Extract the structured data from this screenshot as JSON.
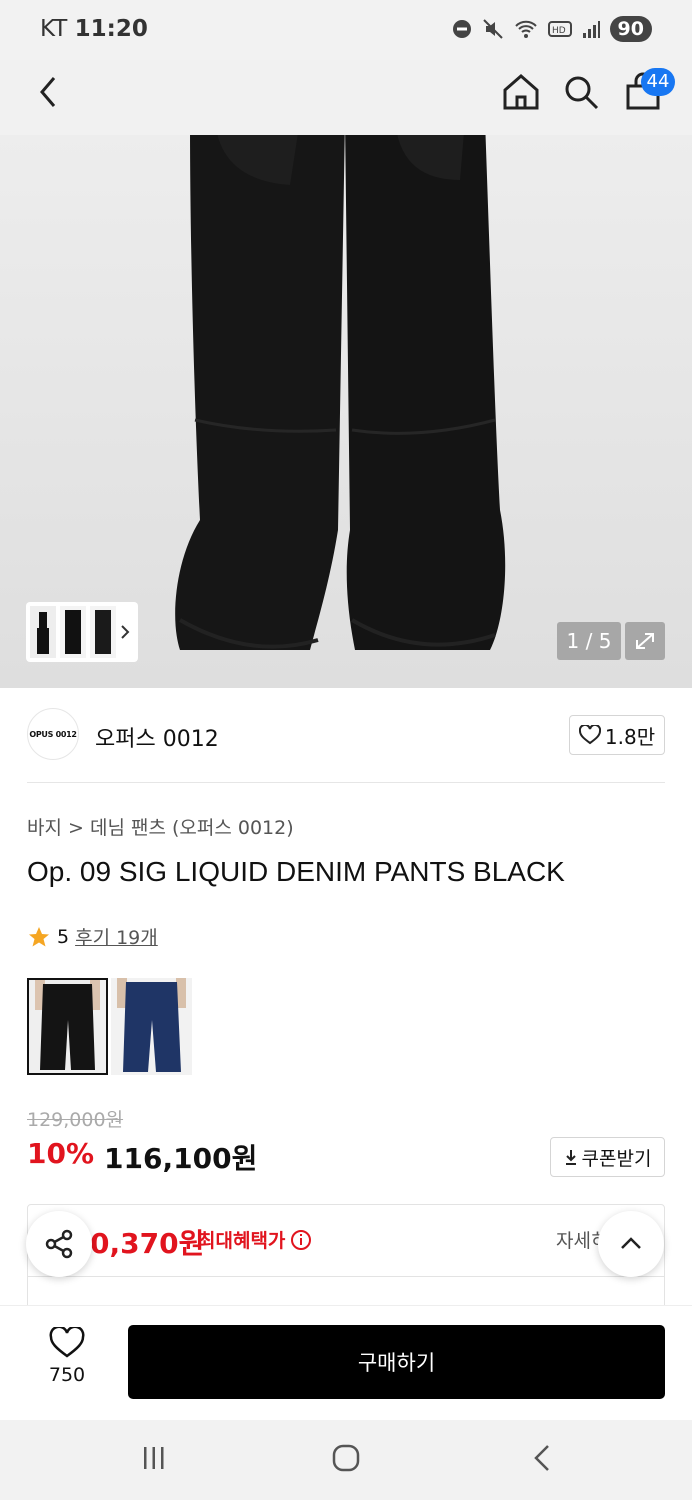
{
  "status_bar": {
    "carrier": "KT",
    "time": "11:20",
    "battery": "90"
  },
  "nav": {
    "cart_count": "44"
  },
  "gallery": {
    "counter": "1 / 5"
  },
  "brand": {
    "logo_text": "OPUS 0012",
    "name": "오퍼스 0012",
    "likes": "1.8만"
  },
  "product": {
    "breadcrumb": "바지 > 데님 팬츠 (오퍼스 0012)",
    "title": "Op. 09 SIG LIQUID DENIM PANTS BLACK",
    "rating": "5",
    "reviews": "후기 19개"
  },
  "price": {
    "original": "129,000원",
    "discount": "10%",
    "sale": "116,100원",
    "coupon_label": "쿠폰받기"
  },
  "benefit": {
    "max_price": "0,370원",
    "label": "최대혜택가",
    "detail": "자세히"
  },
  "bottom": {
    "wish_count": "750",
    "buy_label": "구매하기"
  },
  "colors": {
    "brand_blue": "#1877f2",
    "sale_red": "#e1141e",
    "star": "#f5a623"
  }
}
